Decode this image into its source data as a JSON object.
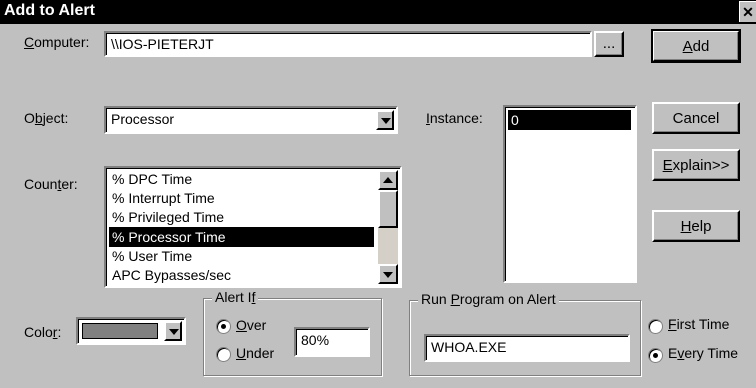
{
  "window": {
    "title": "Add to Alert",
    "close_glyph": "✕"
  },
  "computer": {
    "label_prefix": "",
    "label_u": "C",
    "label_rest": "omputer:",
    "value": "\\\\IOS-PIETERJT",
    "browse_label": "..."
  },
  "object": {
    "label_pre": "O",
    "label_u": "b",
    "label_rest": "ject:",
    "value": "Processor"
  },
  "instance": {
    "label_u": "I",
    "label_rest": "nstance:",
    "items": [
      "0"
    ],
    "selected": "0"
  },
  "counter": {
    "label_pre": "Coun",
    "label_u": "t",
    "label_rest": "er:",
    "items": [
      "% DPC Time",
      "% Interrupt Time",
      "% Privileged Time",
      "% Processor Time",
      "% User Time",
      "APC Bypasses/sec"
    ],
    "selected_index": 3
  },
  "buttons": {
    "add": {
      "u": "A",
      "rest": "dd"
    },
    "cancel": {
      "label": "Cancel"
    },
    "explain": {
      "u": "E",
      "rest": "xplain>>"
    },
    "help": {
      "u": "H",
      "rest": "elp"
    }
  },
  "color": {
    "label_pre": "Colo",
    "label_u": "r",
    "label_rest": ":",
    "swatch": "#808080"
  },
  "alert_if": {
    "title_pre": "Alert I",
    "title_u": "f",
    "title_rest": "",
    "over": {
      "u": "O",
      "rest": "ver",
      "selected": true
    },
    "under": {
      "u": "U",
      "rest": "nder",
      "selected": false
    },
    "value": "80%"
  },
  "run_program": {
    "title_pre": "Run ",
    "title_u": "P",
    "title_rest": "rogram on Alert",
    "value": "WHOA.EXE",
    "first_time": {
      "u": "F",
      "rest": "irst Time",
      "selected": false
    },
    "every_time": {
      "pre": "E",
      "u": "v",
      "rest": "ery Time",
      "selected": true
    }
  }
}
